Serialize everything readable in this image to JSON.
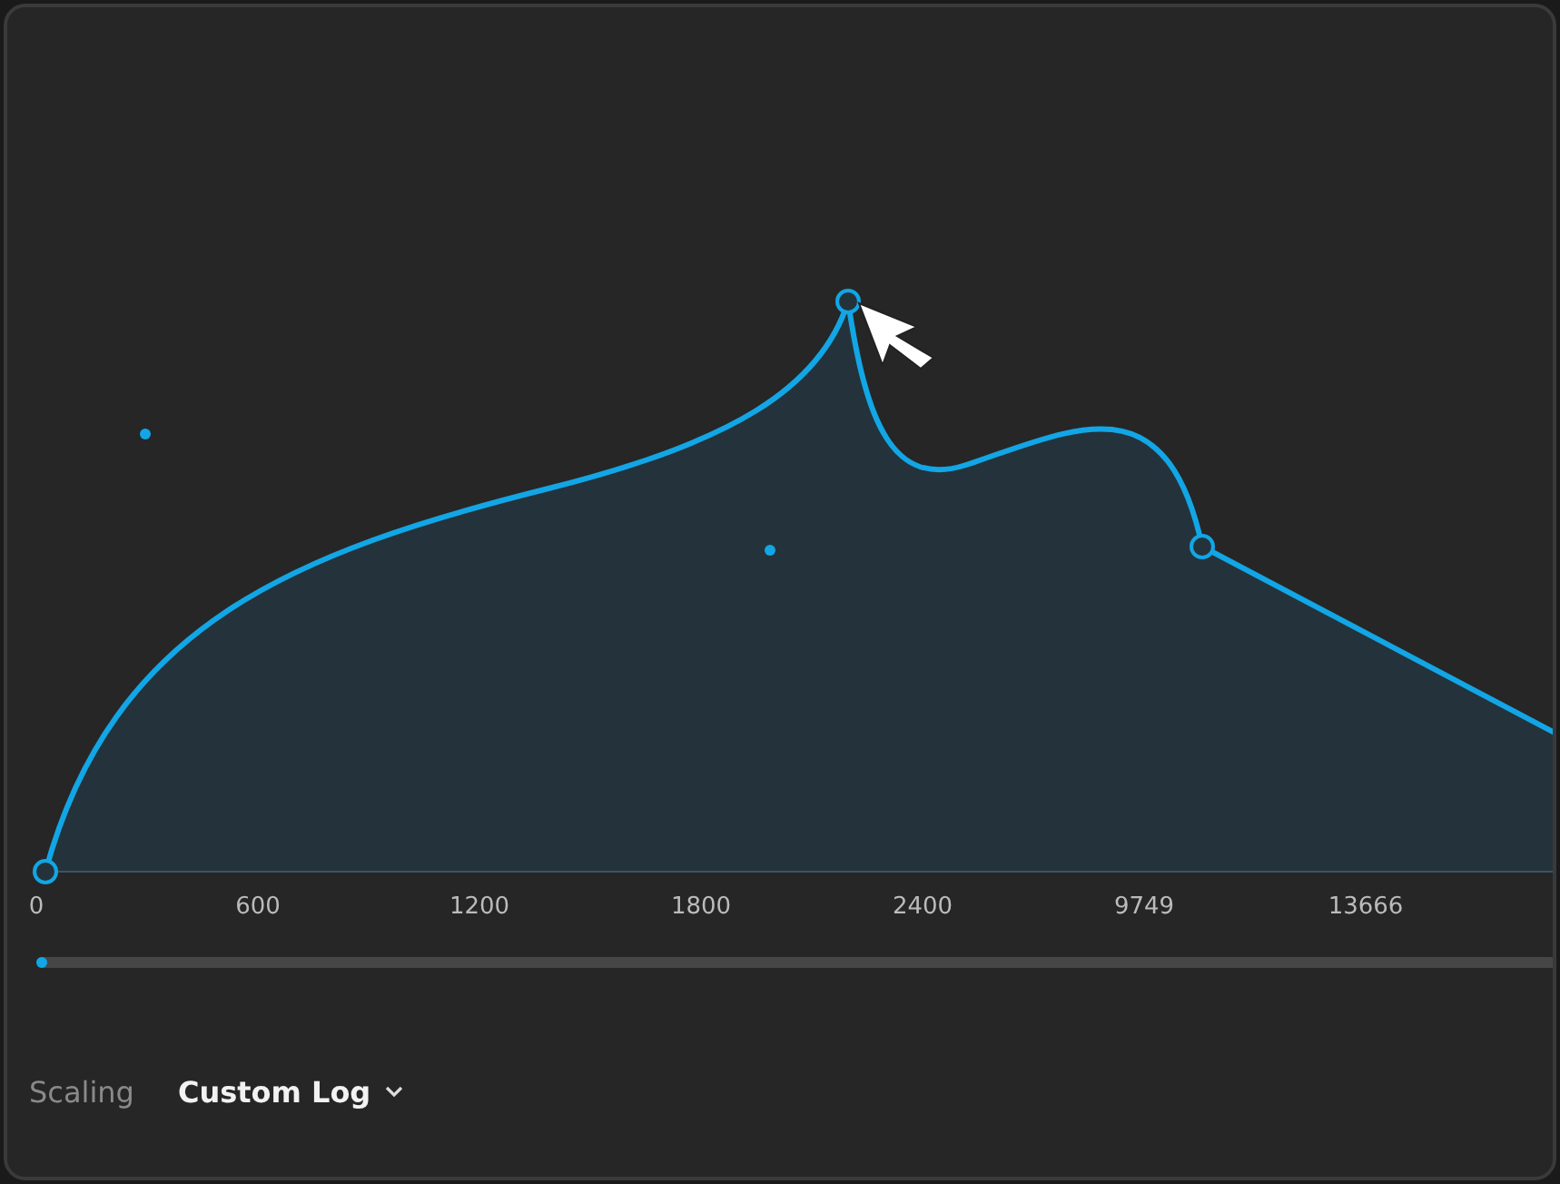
{
  "curve_editor": {
    "x_axis_labels": [
      "0",
      "600",
      "1200",
      "1800",
      "2400",
      "9749",
      "13666"
    ]
  },
  "scaling": {
    "label": "Scaling",
    "value": "Custom Log"
  }
}
